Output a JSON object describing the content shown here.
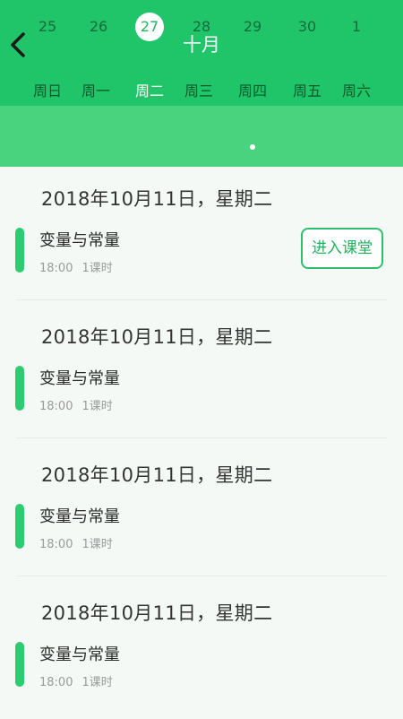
{
  "header": {
    "title": "十月",
    "back_icon": "back-arrow-icon",
    "color": "#20c56a"
  },
  "weekdays": [
    "周日",
    "周一",
    "周二",
    "周三",
    "周四",
    "周五",
    "周六"
  ],
  "dates": [
    "25",
    "26",
    "27",
    "28",
    "29",
    "30",
    "1"
  ],
  "selected_date": "27",
  "event_date": "29",
  "sessions": [
    {
      "date": "2018年10月11日，星期二",
      "course": "变量与常量",
      "time": "18:00",
      "duration": "1课时",
      "button": "进入课堂"
    },
    {
      "date": "2018年10月11日，星期二",
      "course": "变量与常量",
      "time": "18:00",
      "duration": "1课时"
    },
    {
      "date": "2018年10月11日，星期二",
      "course": "变量与常量",
      "time": "18:00",
      "duration": "1课时"
    },
    {
      "date": "2018年10月11日，星期二",
      "course": "变量与常量",
      "time": "18:00",
      "duration": "1课时"
    }
  ]
}
